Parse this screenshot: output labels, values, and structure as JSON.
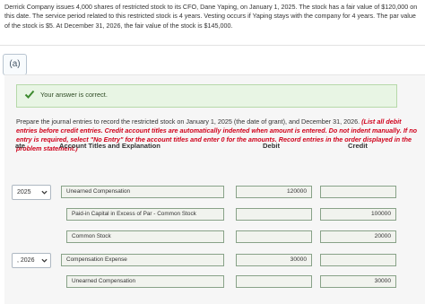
{
  "problem_text": "Derrick Company issues 4,000 shares of restricted stock to its CFO, Dane Yaping, on January 1, 2025. The stock has a fair value of $120,000 on this date. The service period related to this restricted stock is 4 years. Vesting occurs if Yaping stays with the company for 4 years. The par value of the stock is $5. At December 31, 2026, the fair value of the stock is $145,000.",
  "part_label": "(a)",
  "feedback": {
    "icon": "check-icon",
    "text": "Your answer is correct.",
    "color": "#3c8a2e"
  },
  "instructions": {
    "prompt": "Prepare the journal entries to record the restricted stock on January 1, 2025 (the date of grant), and December 31, 2026.",
    "note": "(List all debit entries before credit entries. Credit account titles are automatically indented when amount is entered. Do not indent manually. If no entry is required, select \"No Entry\" for the account titles and enter 0 for the amounts. Record entries in the order displayed in the problem statement.)"
  },
  "table": {
    "headers": {
      "date": "ate",
      "account": "Account Titles and Explanation",
      "debit": "Debit",
      "credit": "Credit"
    },
    "rows": [
      {
        "date": "2025",
        "account": "Unearned Compensation",
        "debit": "120000",
        "credit": ""
      },
      {
        "date": "",
        "account": "Paid-in Capital in Excess of Par - Common Stock",
        "debit": "",
        "credit": "100000"
      },
      {
        "date": "",
        "account": "Common Stock",
        "debit": "",
        "credit": "20000"
      },
      {
        "date": ", 2026",
        "account": "Compensation Expense",
        "debit": "30000",
        "credit": ""
      },
      {
        "date": "",
        "account": "Unearned Compensation",
        "debit": "",
        "credit": "30000"
      }
    ]
  }
}
